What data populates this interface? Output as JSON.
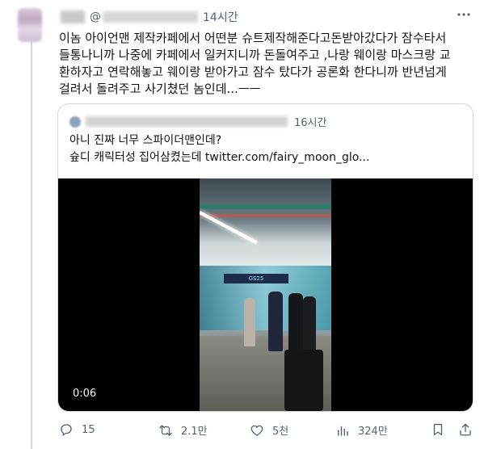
{
  "tweet": {
    "handle_prefix": "@",
    "time": "14시간",
    "text": "이놈 아이언맨 제작카페에서 어떤분 슈트제작해준다고돈받아갔다가 잠수타서\n들통나니까 나중에 카페에서 일커지니까 돈돌여주고 ,나랑 웨이랑 마스크랑 교\n환하자고  연락해놓고 웨이랑 받아가고 잠수 탔다가 공론화 한다니까 반년넘게\n걸려서 돌려주고 사기쳤던 놈인데...ㅡㅡ"
  },
  "quote": {
    "time": "16시간",
    "text": "아니 진짜 너무 스파이더맨인데?\n슢디 캐릭터성 집어삼켰는데  twitter.com/fairy_moon_glo...",
    "video": {
      "duration": "0:06",
      "sign_text": "GS25"
    }
  },
  "actions": {
    "replies": "15",
    "retweets": "2.1만",
    "likes": "5천",
    "views": "324만"
  },
  "icons": [
    "more-icon",
    "reply-icon",
    "retweet-icon",
    "like-icon",
    "views-icon",
    "bookmark-icon",
    "share-icon"
  ],
  "colors": {
    "text": "#0f1419",
    "secondary": "#536471",
    "border": "#cfd9de"
  }
}
